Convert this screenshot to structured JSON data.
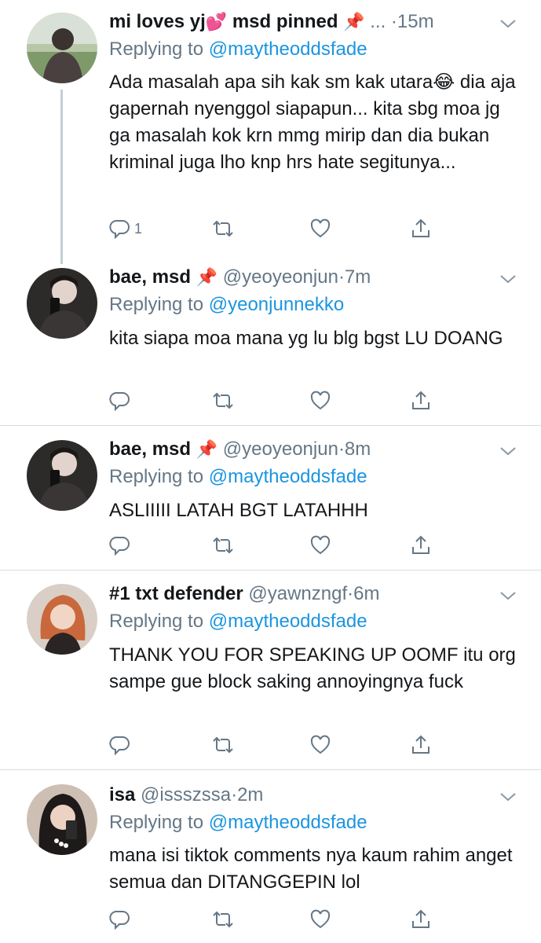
{
  "tweets": [
    {
      "name": "mi loves yj",
      "name_emoji": "💕",
      "name_suffix": "msd pinned",
      "pin": "📌",
      "handle": "...",
      "time": "·15m",
      "replying_prefix": "Replying to",
      "replying_to": "@maytheoddsfade",
      "text": "Ada masalah apa sih kak sm kak utara😂 dia aja gapernah nyenggol siapapun... kita sbg moa jg ga masalah kok krn mmg mirip dan dia bukan kriminal juga lho knp hrs hate segitunya...",
      "reply_count": "1"
    },
    {
      "name": "bae, msd",
      "pin": "📌",
      "handle": "@yeoyeonjun",
      "time": "·7m",
      "replying_prefix": "Replying to",
      "replying_to": "@yeonjunnekko",
      "text": "kita siapa moa mana yg lu blg bgst LU DOANG"
    },
    {
      "name": "bae, msd",
      "pin": "📌",
      "handle": "@yeoyeonjun",
      "time": "·8m",
      "replying_prefix": "Replying to",
      "replying_to": "@maytheoddsfade",
      "text": "ASLIIIII LATAH BGT LATAHHH"
    },
    {
      "name": "#1 txt defender",
      "handle": "@yawnzngf",
      "time": "·6m",
      "replying_prefix": "Replying to",
      "replying_to": "@maytheoddsfade",
      "text": "THANK YOU FOR SPEAKING UP OOMF itu org sampe gue block saking annoyingnya fuck"
    },
    {
      "name": "isa",
      "handle": "@issszssa",
      "time": "·2m",
      "replying_prefix": "Replying to",
      "replying_to": "@maytheoddsfade",
      "text": "mana isi tiktok comments nya kaum rahim anget semua dan DITANGGEPIN lol"
    }
  ],
  "colors": {
    "link": "#1b95e0",
    "secondary": "#657786",
    "divider": "#d8dde1",
    "thread_line": "#c4cfd6"
  },
  "icons": [
    "reply-icon",
    "retweet-icon",
    "like-icon",
    "share-icon",
    "chevron-down-icon"
  ]
}
